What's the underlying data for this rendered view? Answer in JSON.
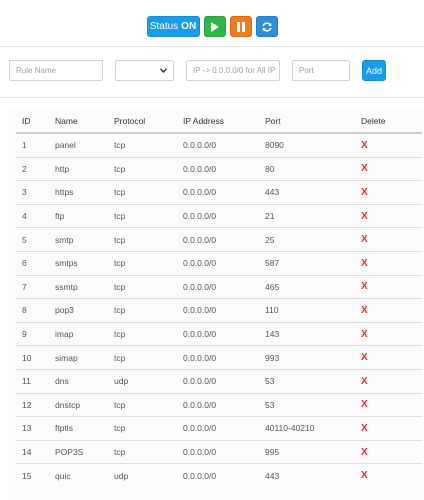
{
  "toolbar": {
    "status_label": "Status",
    "status_value": "ON",
    "play_icon": "play-icon",
    "pause_icon": "pause-icon",
    "refresh_icon": "refresh-icon"
  },
  "form": {
    "rule_name_placeholder": "Rule Name",
    "protocol_value": "",
    "ip_placeholder": "IP -> 0.0.0.0/0 for All IP",
    "port_placeholder": "Port",
    "add_label": "Add"
  },
  "table": {
    "headers": [
      "ID",
      "Name",
      "Protocol",
      "IP Address",
      "Port",
      "Delete"
    ],
    "rows": [
      {
        "id": "1",
        "name": "panel",
        "protocol": "tcp",
        "ip": "0.0.0.0/0",
        "port": "8090",
        "delete": "X"
      },
      {
        "id": "2",
        "name": "http",
        "protocol": "tcp",
        "ip": "0.0.0.0/0",
        "port": "80",
        "delete": "X"
      },
      {
        "id": "3",
        "name": "https",
        "protocol": "tcp",
        "ip": "0.0.0.0/0",
        "port": "443",
        "delete": "X"
      },
      {
        "id": "4",
        "name": "ftp",
        "protocol": "tcp",
        "ip": "0.0.0.0/0",
        "port": "21",
        "delete": "X"
      },
      {
        "id": "5",
        "name": "smtp",
        "protocol": "tcp",
        "ip": "0.0.0.0/0",
        "port": "25",
        "delete": "X"
      },
      {
        "id": "6",
        "name": "smtps",
        "protocol": "tcp",
        "ip": "0.0.0.0/0",
        "port": "587",
        "delete": "X"
      },
      {
        "id": "7",
        "name": "ssmtp",
        "protocol": "tcp",
        "ip": "0.0.0.0/0",
        "port": "465",
        "delete": "X"
      },
      {
        "id": "8",
        "name": "pop3",
        "protocol": "tcp",
        "ip": "0.0.0.0/0",
        "port": "110",
        "delete": "X"
      },
      {
        "id": "9",
        "name": "imap",
        "protocol": "tcp",
        "ip": "0.0.0.0/0",
        "port": "143",
        "delete": "X"
      },
      {
        "id": "10",
        "name": "simap",
        "protocol": "tcp",
        "ip": "0.0.0.0/0",
        "port": "993",
        "delete": "X"
      },
      {
        "id": "11",
        "name": "dns",
        "protocol": "udp",
        "ip": "0.0.0.0/0",
        "port": "53",
        "delete": "X"
      },
      {
        "id": "12",
        "name": "dnstcp",
        "protocol": "tcp",
        "ip": "0.0.0.0/0",
        "port": "53",
        "delete": "X"
      },
      {
        "id": "13",
        "name": "ftptls",
        "protocol": "tcp",
        "ip": "0.0.0.0/0",
        "port": "40110-40210",
        "delete": "X"
      },
      {
        "id": "14",
        "name": "POP3S",
        "protocol": "tcp",
        "ip": "0.0.0.0/0",
        "port": "995",
        "delete": "X"
      },
      {
        "id": "15",
        "name": "quic",
        "protocol": "udp",
        "ip": "0.0.0.0/0",
        "port": "443",
        "delete": "X"
      }
    ]
  },
  "colors": {
    "primary": "#1a9de8",
    "success": "#2fb64a",
    "warning": "#f07c1e",
    "danger": "#e8312a"
  }
}
